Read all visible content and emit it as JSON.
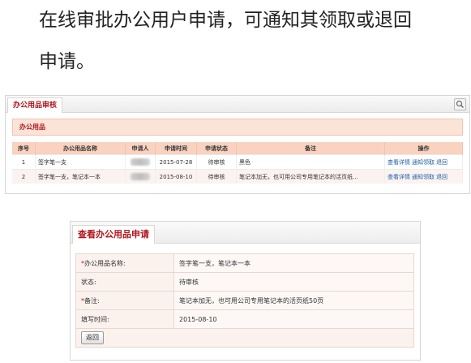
{
  "headline": {
    "line1": "在线审批办公用户申请，可通知其领取或退回",
    "line2": "申请。"
  },
  "list_panel": {
    "tab_label": "办公用品审核",
    "section_title": "办公用品",
    "columns": [
      "序号",
      "办公用品名称",
      "申请人",
      "申请时间",
      "申请状态",
      "备注",
      "操作"
    ],
    "rows": [
      {
        "no": "1",
        "name": "签字笔一支",
        "date": "2015-07-28",
        "status": "待审核",
        "note": "黑色"
      },
      {
        "no": "2",
        "name": "签字笔一支，笔记本一本",
        "date": "2015-08-10",
        "status": "待审核",
        "note": "笔记本加无，也可用公司专用笔记本的活页纸..."
      }
    ],
    "actions": {
      "view": "查看详情",
      "notify": "通知领取",
      "return": "退回"
    }
  },
  "detail_panel": {
    "tab_label": "查看办公用品申请",
    "fields": [
      {
        "required": "*",
        "label": "办公用品名称:",
        "value": "签字笔一支，笔记本一本"
      },
      {
        "required": "",
        "label": "状态:",
        "value": "待审核"
      },
      {
        "required": "*",
        "label": "备注:",
        "value": "笔记本加无，也可用公司专用笔记本的活页纸50页"
      },
      {
        "required": "",
        "label": "填写时间:",
        "value": "2015-08-10"
      }
    ],
    "back_button": "返回"
  }
}
